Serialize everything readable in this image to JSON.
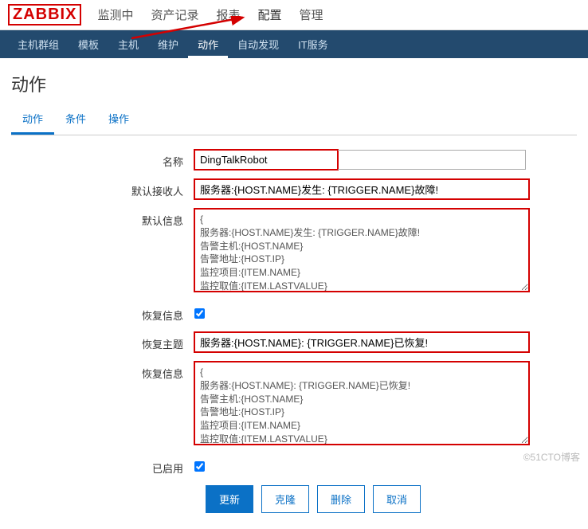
{
  "logo": "ZABBIX",
  "top_menu": [
    "监测中",
    "资产记录",
    "报表",
    "配置",
    "管理"
  ],
  "top_active": 3,
  "sub_menu": [
    "主机群组",
    "模板",
    "主机",
    "维护",
    "动作",
    "自动发现",
    "IT服务"
  ],
  "sub_active": 4,
  "page_title": "动作",
  "tabs": [
    "动作",
    "条件",
    "操作"
  ],
  "tab_active": 0,
  "form": {
    "name_label": "名称",
    "name_value": "DingTalkRobot",
    "recipient_label": "默认接收人",
    "recipient_value": "服务器:{HOST.NAME}发生: {TRIGGER.NAME}故障!",
    "message_label": "默认信息",
    "message_value": "{\n服务器:{HOST.NAME}发生: {TRIGGER.NAME}故障!\n告警主机:{HOST.NAME}\n告警地址:{HOST.IP}\n监控项目:{ITEM.NAME}\n监控取值:{ITEM.LASTVALUE}",
    "recovery_flag_label": "恢复信息",
    "recovery_subject_label": "恢复主题",
    "recovery_subject_value": "服务器:{HOST.NAME}: {TRIGGER.NAME}已恢复!",
    "recovery_message_label": "恢复信息",
    "recovery_message_value": "{\n服务器:{HOST.NAME}: {TRIGGER.NAME}已恢复!\n告警主机:{HOST.NAME}\n告警地址:{HOST.IP}\n监控项目:{ITEM.NAME}\n监控取值:{ITEM.LASTVALUE}",
    "enabled_label": "已启用"
  },
  "buttons": {
    "update": "更新",
    "clone": "克隆",
    "delete": "删除",
    "cancel": "取消"
  },
  "watermark": "©51CTO博客"
}
